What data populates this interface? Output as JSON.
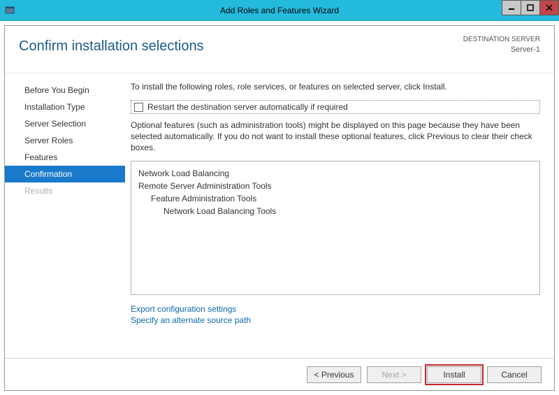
{
  "window": {
    "title": "Add Roles and Features Wizard"
  },
  "header": {
    "page_title": "Confirm installation selections",
    "dest_label": "DESTINATION SERVER",
    "dest_server": "Server-1"
  },
  "sidebar": {
    "items": [
      {
        "label": "Before You Begin"
      },
      {
        "label": "Installation Type"
      },
      {
        "label": "Server Selection"
      },
      {
        "label": "Server Roles"
      },
      {
        "label": "Features"
      },
      {
        "label": "Confirmation"
      },
      {
        "label": "Results"
      }
    ]
  },
  "content": {
    "instruction": "To install the following roles, role services, or features on selected server, click Install.",
    "restart_checkbox_label": "Restart the destination server automatically if required",
    "optional_note": "Optional features (such as administration tools) might be displayed on this page because they have been selected automatically. If you do not want to install these optional features, click Previous to clear their check boxes.",
    "selected_features": {
      "l0a": "Network Load Balancing",
      "l0b": "Remote Server Administration Tools",
      "l1": "Feature Administration Tools",
      "l2": "Network Load Balancing Tools"
    },
    "links": {
      "export": "Export configuration settings",
      "alt_source": "Specify an alternate source path"
    }
  },
  "footer": {
    "previous": "< Previous",
    "next": "Next >",
    "install": "Install",
    "cancel": "Cancel"
  }
}
